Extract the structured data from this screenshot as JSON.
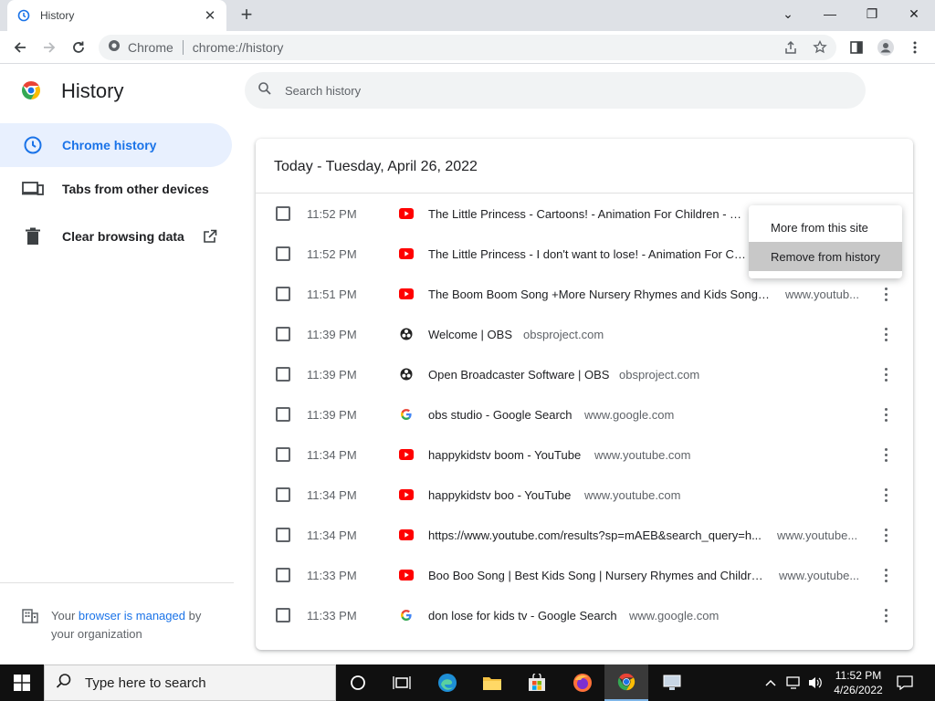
{
  "browser": {
    "tab_title": "History",
    "omnibox_site": "Chrome",
    "omnibox_url": "chrome://history"
  },
  "page": {
    "title": "History",
    "search_placeholder": "Search history"
  },
  "sidebar": {
    "items": [
      {
        "label": "Chrome history",
        "active": true,
        "icon": "clock-icon"
      },
      {
        "label": "Tabs from other devices",
        "active": false,
        "icon": "devices-icon"
      },
      {
        "label": "Clear browsing data",
        "active": false,
        "icon": "trash-icon"
      }
    ],
    "managed": {
      "prefix": "Your",
      "link": "browser is managed",
      "suffix": "by",
      "line2": "your organization"
    }
  },
  "history": {
    "date_header": "Today - Tuesday, April 26, 2022",
    "rows": [
      {
        "time": "11:52 PM",
        "favicon": "youtube-icon",
        "title": "The Little Princess - Cartoons! - Animation For Children - Yo...",
        "domain": ""
      },
      {
        "time": "11:52 PM",
        "favicon": "youtube-icon",
        "title": "The Little Princess - I don't want to lose! - Animation For Child...",
        "domain": ""
      },
      {
        "time": "11:51 PM",
        "favicon": "youtube-icon",
        "title": "The Boom Boom Song +More Nursery Rhymes and Kids Songs ...",
        "domain": "www.youtub..."
      },
      {
        "time": "11:39 PM",
        "favicon": "obs-icon",
        "title": "Welcome | OBS",
        "domain": "obsproject.com"
      },
      {
        "time": "11:39 PM",
        "favicon": "obs-icon",
        "title": "Open Broadcaster Software | OBS",
        "domain": "obsproject.com"
      },
      {
        "time": "11:39 PM",
        "favicon": "google-icon",
        "title": "obs studio - Google Search",
        "domain": "www.google.com"
      },
      {
        "time": "11:34 PM",
        "favicon": "youtube-icon",
        "title": "happykidstv boom - YouTube",
        "domain": "www.youtube.com"
      },
      {
        "time": "11:34 PM",
        "favicon": "youtube-icon",
        "title": "happykidstv boo - YouTube",
        "domain": "www.youtube.com"
      },
      {
        "time": "11:34 PM",
        "favicon": "youtube-icon",
        "title": "https://www.youtube.com/results?sp=mAEB&search_query=h...",
        "domain": "www.youtube..."
      },
      {
        "time": "11:33 PM",
        "favicon": "youtube-icon",
        "title": "Boo Boo Song | Best Kids Song | Nursery Rhymes and Children...",
        "domain": "www.youtube..."
      },
      {
        "time": "11:33 PM",
        "favicon": "google-icon",
        "title": "don lose for kids tv - Google Search",
        "domain": "www.google.com"
      }
    ]
  },
  "context_menu": {
    "items": [
      "More from this site",
      "Remove from history"
    ],
    "highlighted": "Remove from history"
  },
  "taskbar": {
    "search_text": "Type here to search",
    "time": "11:52 PM",
    "date": "4/26/2022"
  }
}
